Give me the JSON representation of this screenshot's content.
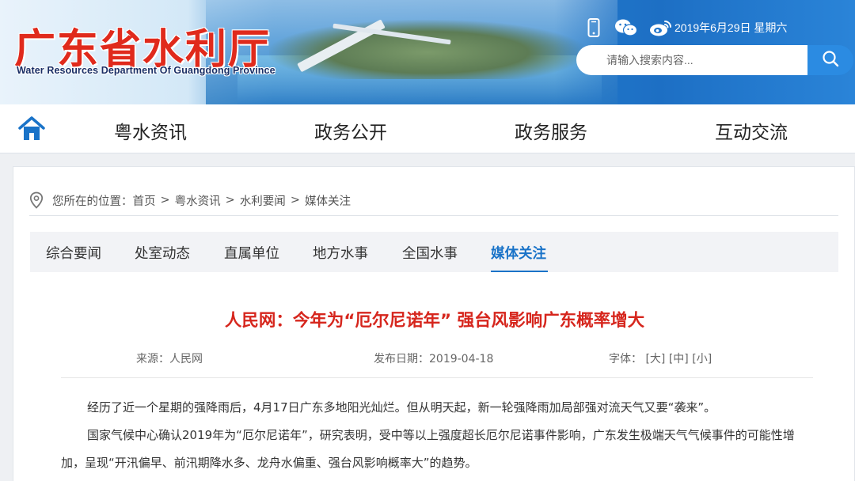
{
  "header": {
    "logo_cn": "广东省水利厅",
    "logo_en": "Water Resources Department Of Guangdong Province",
    "date": "2019年6月29日 星期六",
    "icons": [
      "mobile-icon",
      "wechat-icon",
      "weibo-icon"
    ],
    "search": {
      "placeholder": "请输入搜索内容..."
    }
  },
  "nav": {
    "items": [
      {
        "label": "粤水资讯"
      },
      {
        "label": "政务公开"
      },
      {
        "label": "政务服务"
      },
      {
        "label": "互动交流"
      }
    ]
  },
  "breadcrumb": {
    "prefix": "您所在的位置：",
    "items": [
      "首页",
      "粤水资讯",
      "水利要闻",
      "媒体关注"
    ],
    "separator": ">"
  },
  "subtabs": {
    "items": [
      {
        "label": "综合要闻",
        "active": false
      },
      {
        "label": "处室动态",
        "active": false
      },
      {
        "label": "直属单位",
        "active": false
      },
      {
        "label": "地方水事",
        "active": false
      },
      {
        "label": "全国水事",
        "active": false
      },
      {
        "label": "媒体关注",
        "active": true
      }
    ]
  },
  "article": {
    "title": "人民网：今年为“厄尔尼诺年” 强台风影响广东概率增大",
    "source_label": "来源：",
    "source": "人民网",
    "date_label": "发布日期：",
    "date": "2019-04-18",
    "font_label": "字体：",
    "font_sizes": [
      "[大]",
      "[中]",
      "[小]"
    ],
    "paragraphs": [
      "经历了近一个星期的强降雨后，4月17日广东多地阳光灿烂。但从明天起，新一轮强降雨加局部强对流天气又要“袭来”。",
      "国家气候中心确认2019年为“厄尔尼诺年”，研究表明，受中等以上强度超长厄尔尼诺事件影响，广东发生极端天气气候事件的可能性增加，呈现“开汛偏早、前汛期降水多、龙舟水偏重、强台风影响概率大”的趋势。"
    ]
  },
  "colors": {
    "brand_red": "#e02a1c",
    "title_red": "#d6261d",
    "accent_blue": "#1a73c8",
    "search_blue": "#2b8be2"
  }
}
